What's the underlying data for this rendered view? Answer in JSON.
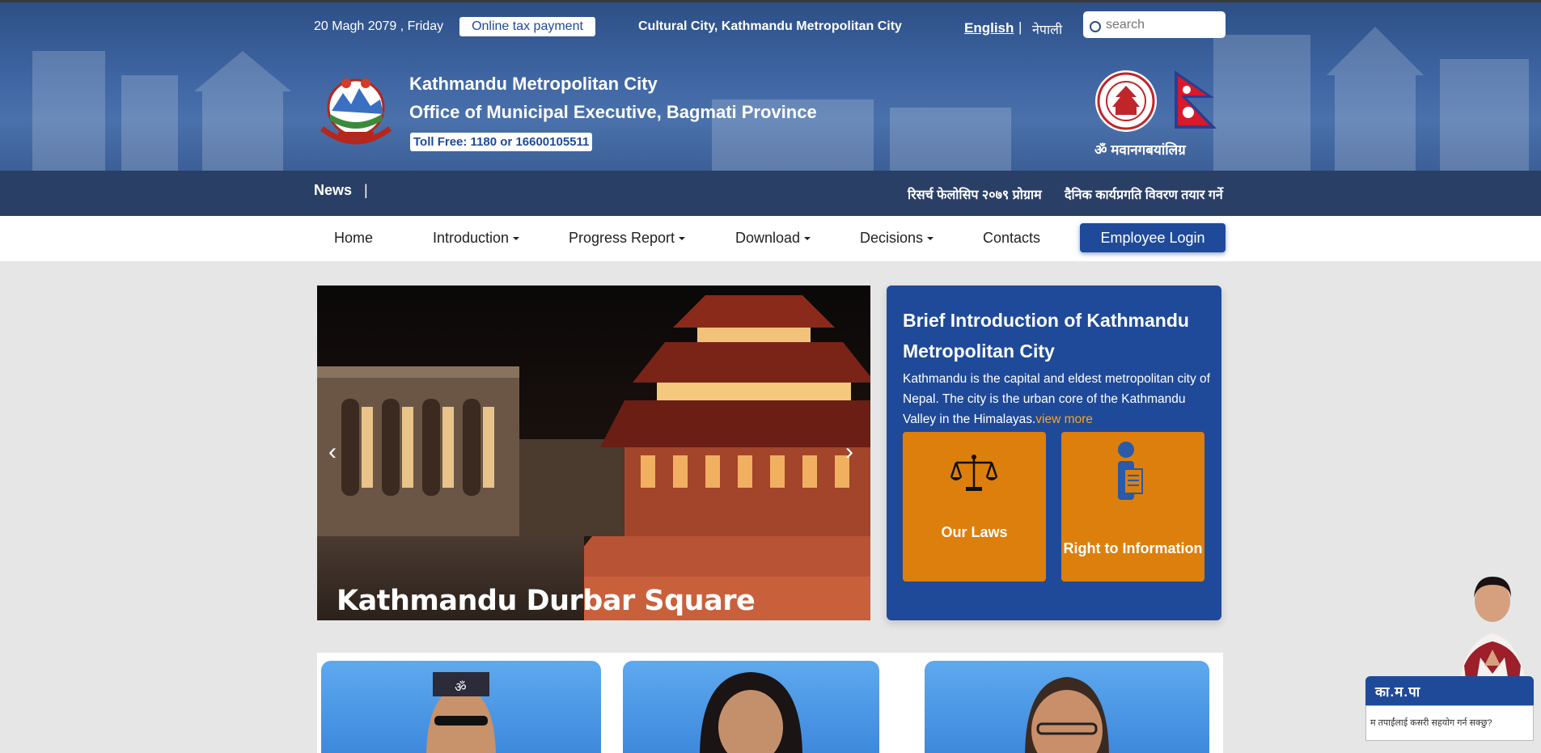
{
  "topbar": {
    "date": "20 Magh 2079 , Friday",
    "tax_button": "Online tax payment",
    "slogan": "Cultural City, Kathmandu Metropolitan City",
    "lang_english": "English",
    "lang_separator": "|",
    "lang_nepali": "नेपाली",
    "search_placeholder": "search"
  },
  "header": {
    "title_line1": "Kathmandu Metropolitan City",
    "title_line2": "Office of Municipal Executive, Bagmati Province",
    "toll_free": "Toll Free: 1180 or 16600105511",
    "seal_caption": "ॐ मवानगबयांलिग्र"
  },
  "news": {
    "label": "News",
    "separator": "|",
    "items": [
      "रिसर्च फेलोसिप २०७९ प्रोग्राम",
      "दैनिक कार्यप्रगति विवरण तयार गर्ने"
    ]
  },
  "nav": {
    "items": [
      {
        "label": "Home",
        "dropdown": false
      },
      {
        "label": "Introduction",
        "dropdown": true
      },
      {
        "label": "Progress Report",
        "dropdown": true
      },
      {
        "label": "Download",
        "dropdown": true
      },
      {
        "label": "Decisions",
        "dropdown": true
      },
      {
        "label": "Contacts",
        "dropdown": false
      }
    ],
    "login_button": "Employee Login"
  },
  "slider": {
    "caption": "Kathmandu Durbar Square",
    "prev_icon": "chevron-left-icon",
    "next_icon": "chevron-right-icon"
  },
  "intro": {
    "title": "Brief Introduction of Kathmandu Metropolitan City",
    "text": "Kathmandu is the capital and eldest metropolitan city of Nepal. The city is the urban core of the Kathmandu Valley in the Himalayas.",
    "view_more": "view more",
    "tiles": [
      {
        "label": "Our Laws",
        "icon": "scales-icon"
      },
      {
        "label": "Right to Information",
        "icon": "information-person-icon"
      }
    ]
  },
  "chatbot": {
    "title": "का.म.पा",
    "message": "म तपाईंलाई कसरी सहयोग गर्न सक्छु?"
  },
  "colors": {
    "brand_blue": "#1f4a99",
    "news_bar": "#2a3f66",
    "tile_orange": "#dd7f0c",
    "link_orange": "#f5a623"
  }
}
